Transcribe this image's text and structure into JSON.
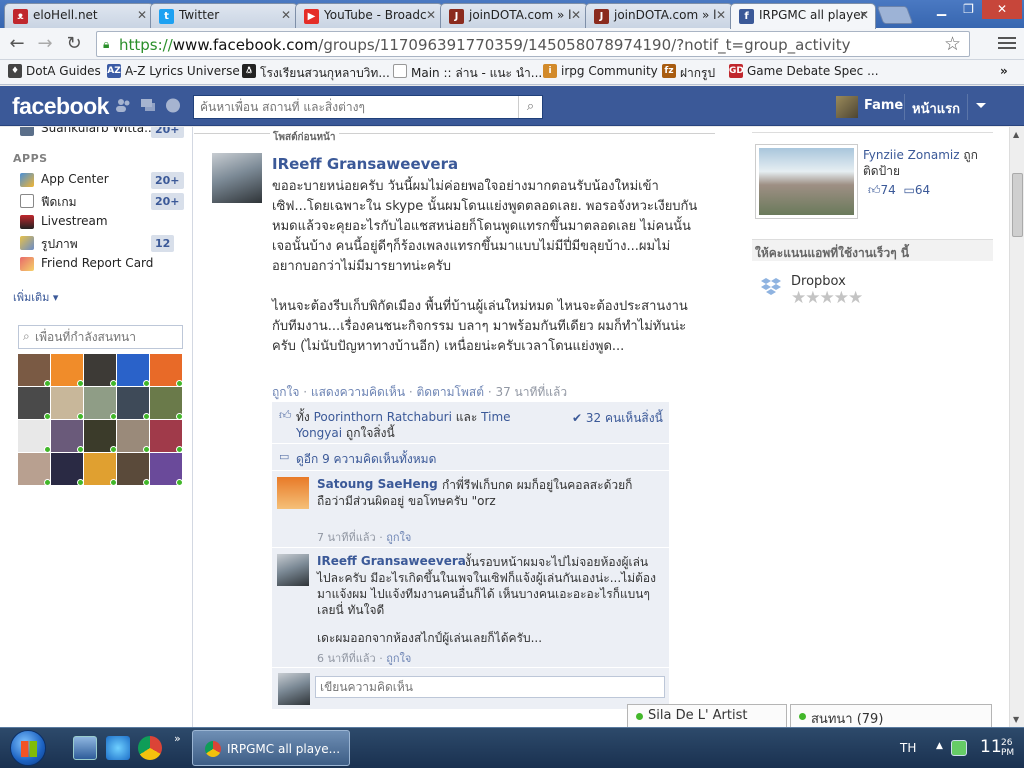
{
  "browser": {
    "tabs": [
      {
        "title": "eloHell.net",
        "icon": "elohell-icon",
        "color": "#c0272d"
      },
      {
        "title": "Twitter",
        "icon": "twitter-icon",
        "color": "#1da1f2"
      },
      {
        "title": "YouTube - Broadc",
        "icon": "youtube-icon",
        "color": "#e52d27"
      },
      {
        "title": "joinDOTA.com » l",
        "icon": "joindota-icon",
        "color": "#8b2b1e"
      },
      {
        "title": "joinDOTA.com » l",
        "icon": "joindota-icon",
        "color": "#8b2b1e"
      },
      {
        "title": "IRPGMC all player",
        "icon": "facebook-icon",
        "color": "#3b5998"
      }
    ],
    "url_scheme": "https://",
    "url_host": "www.facebook.com",
    "url_path": "/groups/117096391770359/145058078974190/?notif_t=group_activity",
    "bookmarks": [
      {
        "label": "DotA Guides",
        "icon": "dota-icon",
        "color": "#444"
      },
      {
        "label": "A-Z Lyrics Universe",
        "icon": "az-icon",
        "color": "#3b5ba5"
      },
      {
        "label": "โรงเรียนสวนกุหลาบวิท...",
        "icon": "linux-tux-icon",
        "color": "#222"
      },
      {
        "label": "Main :: ล่าน - แนะ นำ...",
        "icon": "page-icon",
        "color": "#999"
      },
      {
        "label": "irpg Community",
        "icon": "irpg-icon",
        "color": "#d28a2a"
      },
      {
        "label": "ฝากรูป",
        "icon": "fagroop-icon",
        "color": "#a85c10"
      },
      {
        "label": "Game Debate Spec ...",
        "icon": "gamedebate-icon",
        "color": "#c0272d"
      }
    ]
  },
  "facebook": {
    "logo": "facebook",
    "search_placeholder": "ค้นหาเพื่อน สถานที่ และสิ่งต่างๆ",
    "user_name": "Fame",
    "home_label": "หน้าแรก"
  },
  "sidebar": {
    "top_item": {
      "label": "Suankularb Witta...",
      "count": "20+"
    },
    "apps_header": "APPS",
    "apps": [
      {
        "label": "App Center",
        "count": "20+",
        "icon": "app-center-icon"
      },
      {
        "label": "ฟีดเกม",
        "count": "20+",
        "icon": "games-feed-icon"
      },
      {
        "label": "Livestream",
        "count": "",
        "icon": "livestream-icon"
      },
      {
        "label": "รูปภาพ",
        "count": "12",
        "icon": "photos-icon"
      },
      {
        "label": "Friend Report Card",
        "count": "",
        "icon": "report-card-icon"
      }
    ],
    "more_label": "เพิ่มเติม",
    "chat_search_placeholder": "เพื่อนที่กำลังสนทนา"
  },
  "post": {
    "section_label": "โพสต์ก่อนหน้า",
    "author": "IReeff Gransaweevera",
    "paragraphs": [
      "ขออะบายหน่อยครับ วันนี้ผมไม่ค่อยพอใจอย่างมากตอนรับน้องใหม่เข้าเซิฟ...โดยเฉพาะใน skype นั้นผมโดนแย่งพูดตลอดเลย. พอรอจังหวะเงียบกันหมดแล้วจะคุยอะไรกับไอแชสหน่อยก็โดนพูดแทรกขึ้นมาตลอดเลย ไม่คนนั้นเจอนั้นบ้าง คนนี้อยู่ดีๆก็ร้องเพลงแทรกขึ้นมาแบบไม่มีปี่มีขลุยบ้าง...ผมไม่อยากบอกว่าไม่มีมารยาทน่ะครับ",
      "ไหนจะต้องรีบเก็บพิกัดเมือง พื้นที่บ้านผู้เล่นใหม่หมด ไหนจะต้องประสานงานกับทีมงาน...เรื่องคนชนะกิจกรรม บลาๆ มาพร้อมกันทีเดียว ผมก็ทำไม่ทันน่ะครับ (ไม่นับปัญหาทางบ้านอีก) เหนื่อยน่ะครับเวลาโดนแย่งพูด..."
    ],
    "like_link": "ถูกใจ",
    "comment_link": "แสดงความคิดเห็น",
    "follow_link": "ติดตามโพสต์",
    "time": "37 นาทีที่แล้ว",
    "likes_prefix": "ทั้ง",
    "liker1": "Poorinthorn Ratchaburi",
    "likes_and": "และ",
    "liker2": "Time Yongyai",
    "likes_suffix": "ถูกใจสิ่งนี้",
    "seen": "32 คนเห็นสิ่งนี้",
    "view_more": "ดูอีก 9 ความคิดเห็นทั้งหมด",
    "comments": [
      {
        "author": "Satoung SaeHeng",
        "text": "กำพี่รีฟเก็บกด ผมก็อยู่ในคอลสะด้วยก็ถือว่ามีส่วนผิดอยู่ ขอโทษครับ \"orz",
        "time": "7 นาทีที่แล้ว",
        "like": "ถูกใจ"
      },
      {
        "author": "IReeff Gransaweevera",
        "text": "งั้นรอบหน้าผมจะไปไม่จอยห้องผู้เล่นไปละครับ มีอะไรเกิดขึ้นในเพจในเซิฟก็แจ้งผู้เล่นกันเองน่ะ...ไม่ต้องมาแจ้งผม ไปแจ้งทีมงานคนอื่นก็ได้ เห็นบางคนเอะอะอะไรก็แบนๆเลยนี่ ทันใจดี",
        "text2": "เดะผมออกจากห้องสไกป์ผู้เล่นเลยก็ได้ครับ...",
        "time": "6 นาทีที่แล้ว",
        "like": "ถูกใจ"
      }
    ],
    "write_placeholder": "เขียนความคิดเห็น"
  },
  "right": {
    "photo_user": "Fynziie Zonamiz",
    "photo_caption": "ถูกติดป้าย",
    "likes": "74",
    "comments": "64",
    "apps_header": "ให้คะแนนแอพที่ใช้งานเร็วๆ นี้",
    "app_name": "Dropbox",
    "stars": "★★★★★"
  },
  "chat": {
    "friend": "Sila De L' Artist",
    "online": "สนทนา (79)"
  },
  "taskbar": {
    "window_title": "IRPGMC all playe...",
    "lang": "TH",
    "clock_hour": "11",
    "clock_min": "26",
    "clock_ampm": "PM"
  }
}
